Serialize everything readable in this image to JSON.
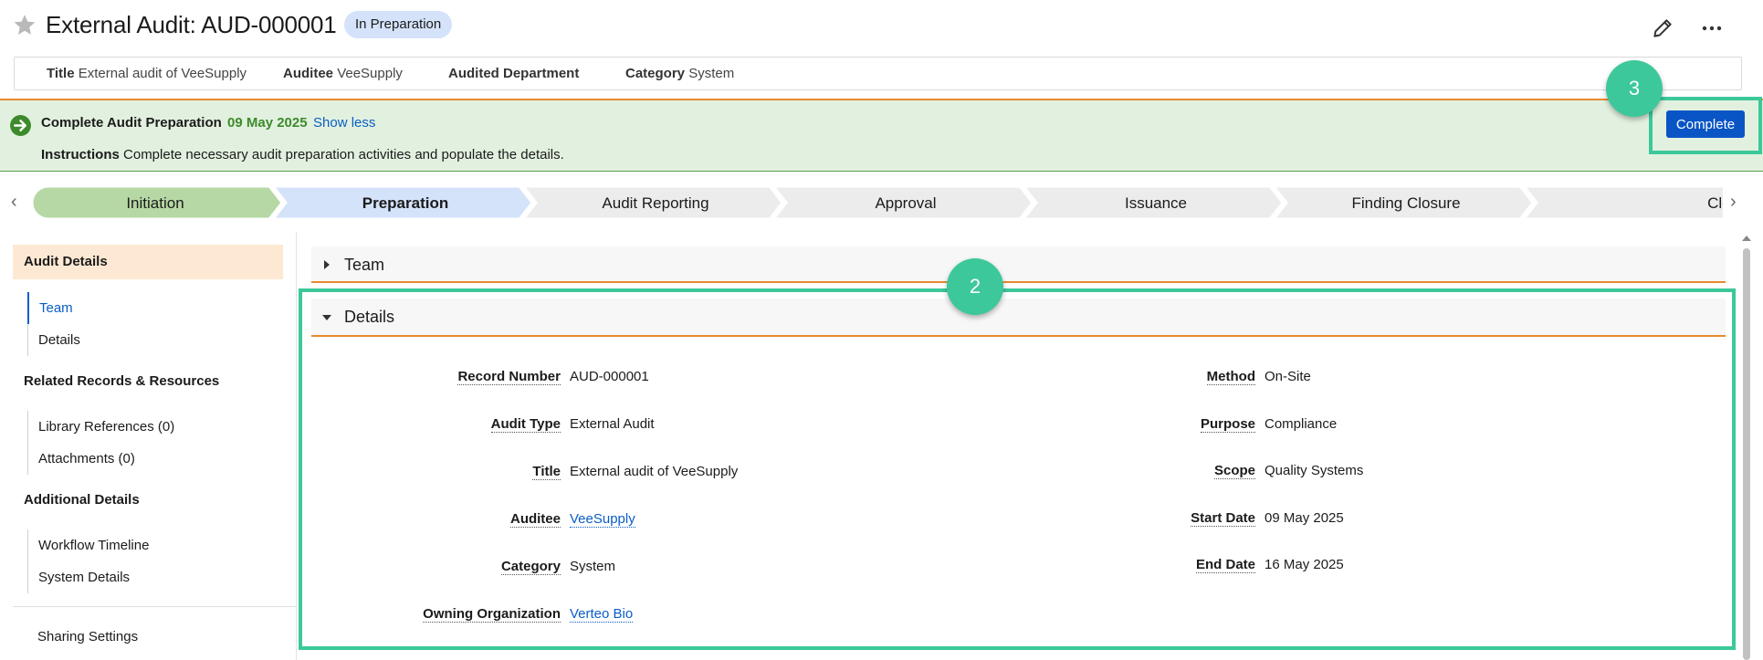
{
  "header": {
    "title": "External Audit: AUD-000001",
    "status": "In Preparation"
  },
  "summary": {
    "title_label": "Title",
    "title_value": "External audit of VeeSupply",
    "auditee_label": "Auditee",
    "auditee_value": "VeeSupply",
    "dept_label": "Audited Department",
    "category_label": "Category",
    "category_value": "System"
  },
  "banner": {
    "title": "Complete Audit Preparation",
    "date": "09 May 2025",
    "toggle_link": "Show less",
    "instructions_label": "Instructions",
    "instructions_text": "Complete necessary audit preparation activities and populate the details.",
    "complete_button": "Complete"
  },
  "callouts": {
    "complete": "3",
    "details": "2"
  },
  "stepper": {
    "steps": [
      {
        "label": "Initiation",
        "state": "done"
      },
      {
        "label": "Preparation",
        "state": "current"
      },
      {
        "label": "Audit Reporting",
        "state": "future"
      },
      {
        "label": "Approval",
        "state": "future"
      },
      {
        "label": "Issuance",
        "state": "future"
      },
      {
        "label": "Finding Closure",
        "state": "future"
      },
      {
        "label": "Closed",
        "state": "future"
      }
    ],
    "colors": {
      "done": "#b5d8a4",
      "current": "#d4e3fa",
      "future": "#ececec"
    }
  },
  "sidebar": {
    "audit_details": "Audit Details",
    "team": "Team",
    "details": "Details",
    "related": "Related Records & Resources",
    "library": "Library References (0)",
    "attachments": "Attachments (0)",
    "additional": "Additional Details",
    "workflow": "Workflow Timeline",
    "system": "System Details",
    "sharing": "Sharing Settings"
  },
  "sections": {
    "team": "Team",
    "details": "Details"
  },
  "details": {
    "record_number_label": "Record Number",
    "record_number": "AUD-000001",
    "audit_type_label": "Audit Type",
    "audit_type": "External Audit",
    "title_label": "Title",
    "title": "External audit of VeeSupply",
    "auditee_label": "Auditee",
    "auditee": "VeeSupply",
    "category_label": "Category",
    "category": "System",
    "owning_org_label": "Owning Organization",
    "owning_org": "Verteo Bio",
    "method_label": "Method",
    "method": "On-Site",
    "purpose_label": "Purpose",
    "purpose": "Compliance",
    "scope_label": "Scope",
    "scope": "Quality Systems",
    "start_date_label": "Start Date",
    "start_date": "09 May 2025",
    "end_date_label": "End Date",
    "end_date": "16 May 2025"
  }
}
